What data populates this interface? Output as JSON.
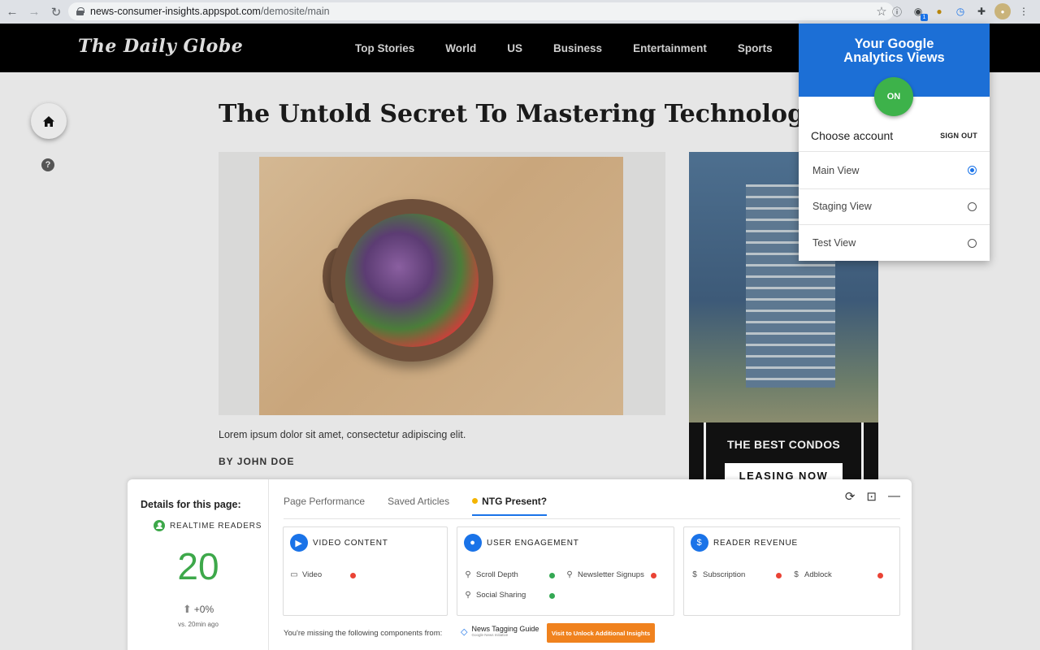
{
  "browser": {
    "url_host": "news-consumer-insights.appspot.com",
    "url_path": "/demosite/main",
    "nav_icons": [
      "back-icon",
      "forward-icon",
      "reload-icon"
    ],
    "extension_icons": [
      "info-icon",
      "analytics-extension-icon",
      "media-extension-icon",
      "clock-extension-icon",
      "puzzle-icon",
      "profile-avatar",
      "menu-icon"
    ]
  },
  "site": {
    "logo": "The Daily Globe",
    "nav": [
      "Top Stories",
      "World",
      "US",
      "Business",
      "Entertainment",
      "Sports"
    ]
  },
  "article": {
    "headline": "The Untold Secret To Mastering Technology In Just",
    "caption": "Lorem ipsum dolor sit amet, consectetur adipiscing elit.",
    "byline": "BY JOHN DOE"
  },
  "ad": {
    "text": "THE BEST CONDOS",
    "button": "LEASING NOW"
  },
  "popup": {
    "title_line1": "Your Google",
    "title_line2": "Analytics Views",
    "toggle": "ON",
    "choose_account": "Choose account",
    "sign_out": "SIGN OUT",
    "views": [
      {
        "label": "Main View",
        "selected": true
      },
      {
        "label": "Staging View",
        "selected": false
      },
      {
        "label": "Test View",
        "selected": false
      }
    ]
  },
  "panel": {
    "details_title": "Details for this page:",
    "realtime_label": "REALTIME READERS",
    "realtime_value": "20",
    "delta": "+0%",
    "vs": "vs. 20min ago",
    "tabs": [
      "Page Performance",
      "Saved Articles",
      "NTG Present?"
    ],
    "active_tab": "NTG Present?",
    "cards": [
      {
        "title": "VIDEO CONTENT",
        "icon": "video-camera-icon",
        "metrics": [
          {
            "label": "Video",
            "status": "red"
          }
        ]
      },
      {
        "title": "USER ENGAGEMENT",
        "icon": "user-icon",
        "metrics": [
          {
            "label": "Scroll Depth",
            "status": "green"
          },
          {
            "label": "Newsletter Signups",
            "status": "red"
          },
          {
            "label": "Social Sharing",
            "status": "green"
          }
        ]
      },
      {
        "title": "READER REVENUE",
        "icon": "dollar-icon",
        "metrics": [
          {
            "label": "Subscription",
            "status": "red"
          },
          {
            "label": "Adblock",
            "status": "red"
          }
        ]
      }
    ],
    "missing_text": "You're missing the following components from:",
    "ntg_title": "News Tagging Guide",
    "ntg_sub": "Google News Initiative",
    "unlock_button": "Visit to Unlock Additional Insights"
  },
  "colors": {
    "popup_blue": "#1c6fd6",
    "on_green": "#3db24a",
    "realtime_green": "#3da84a",
    "status_red": "#ea4335",
    "status_green": "#34a853",
    "unlock_orange": "#f0821e",
    "tab_accent": "#1a73e8"
  }
}
